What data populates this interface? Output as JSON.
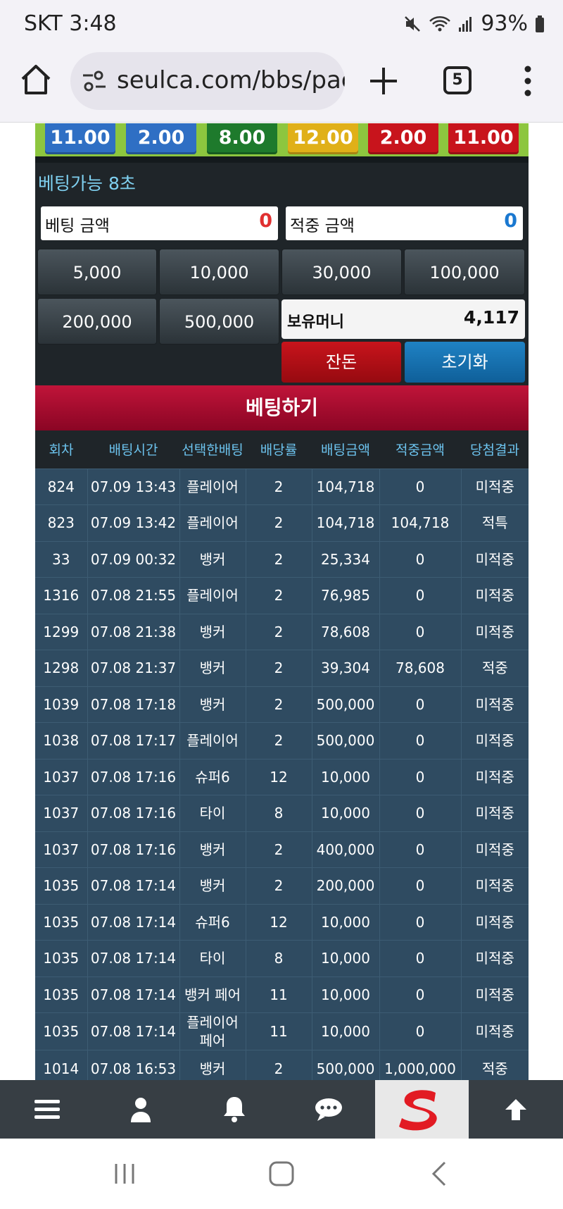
{
  "status_bar": {
    "carrier_time": "SKT 3:48",
    "battery": "93%"
  },
  "browser": {
    "url": "seulca.com/bbs/pag",
    "tab_count": "5"
  },
  "odds": [
    {
      "value": "11.00",
      "color": "#2f6fc4"
    },
    {
      "value": "2.00",
      "color": "#2f6fc4"
    },
    {
      "value": "8.00",
      "color": "#1e7a2c"
    },
    {
      "value": "12.00",
      "color": "#e0b018"
    },
    {
      "value": "2.00",
      "color": "#c8141c"
    },
    {
      "value": "11.00",
      "color": "#c8141c"
    }
  ],
  "timer": "베팅가능 8초",
  "bet_amount": {
    "label": "베팅 금액",
    "value": "0",
    "color": "#e03030"
  },
  "win_amount": {
    "label": "적중 금액",
    "value": "0",
    "color": "#1a78d0"
  },
  "chips": [
    "5,000",
    "10,000",
    "30,000",
    "100,000",
    "200,000",
    "500,000"
  ],
  "holding": {
    "label": "보유머니",
    "value": "4,117"
  },
  "buttons": {
    "change": "잔돈",
    "reset": "초기화",
    "bet": "베팅하기"
  },
  "table": {
    "headers": [
      "회차",
      "배팅시간",
      "선택한배팅",
      "배당률",
      "배팅금액",
      "적중금액",
      "당첨결과"
    ],
    "rows": [
      [
        "824",
        "07.09 13:43",
        "플레이어",
        "2",
        "104,718",
        "0",
        "미적중",
        "lose"
      ],
      [
        "823",
        "07.09 13:42",
        "플레이어",
        "2",
        "104,718",
        "104,718",
        "적특",
        "gold"
      ],
      [
        "33",
        "07.09 00:32",
        "뱅커",
        "2",
        "25,334",
        "0",
        "미적중",
        "lose"
      ],
      [
        "1316",
        "07.08 21:55",
        "플레이어",
        "2",
        "76,985",
        "0",
        "미적중",
        "lose"
      ],
      [
        "1299",
        "07.08 21:38",
        "뱅커",
        "2",
        "78,608",
        "0",
        "미적중",
        "lose"
      ],
      [
        "1298",
        "07.08 21:37",
        "뱅커",
        "2",
        "39,304",
        "78,608",
        "적중",
        "green"
      ],
      [
        "1039",
        "07.08 17:18",
        "뱅커",
        "2",
        "500,000",
        "0",
        "미적중",
        "lose"
      ],
      [
        "1038",
        "07.08 17:17",
        "플레이어",
        "2",
        "500,000",
        "0",
        "미적중",
        "lose"
      ],
      [
        "1037",
        "07.08 17:16",
        "슈퍼6",
        "12",
        "10,000",
        "0",
        "미적중",
        "lose"
      ],
      [
        "1037",
        "07.08 17:16",
        "타이",
        "8",
        "10,000",
        "0",
        "미적중",
        "lose"
      ],
      [
        "1037",
        "07.08 17:16",
        "뱅커",
        "2",
        "400,000",
        "0",
        "미적중",
        "lose"
      ],
      [
        "1035",
        "07.08 17:14",
        "뱅커",
        "2",
        "200,000",
        "0",
        "미적중",
        "lose"
      ],
      [
        "1035",
        "07.08 17:14",
        "슈퍼6",
        "12",
        "10,000",
        "0",
        "미적중",
        "lose"
      ],
      [
        "1035",
        "07.08 17:14",
        "타이",
        "8",
        "10,000",
        "0",
        "미적중",
        "lose"
      ],
      [
        "1035",
        "07.08 17:14",
        "뱅커 페어",
        "11",
        "10,000",
        "0",
        "미적중",
        "lose"
      ],
      [
        "1035",
        "07.08 17:14",
        "플레이어 페어",
        "11",
        "10,000",
        "0",
        "미적중",
        "lose"
      ],
      [
        "1014",
        "07.08 16:53",
        "뱅커",
        "2",
        "500,000",
        "1,000,000",
        "적중",
        "green"
      ]
    ]
  },
  "bottom_nav": [
    "menu-icon",
    "user-icon",
    "bell-icon",
    "chat-icon",
    "logo",
    "arrow-up-icon"
  ]
}
